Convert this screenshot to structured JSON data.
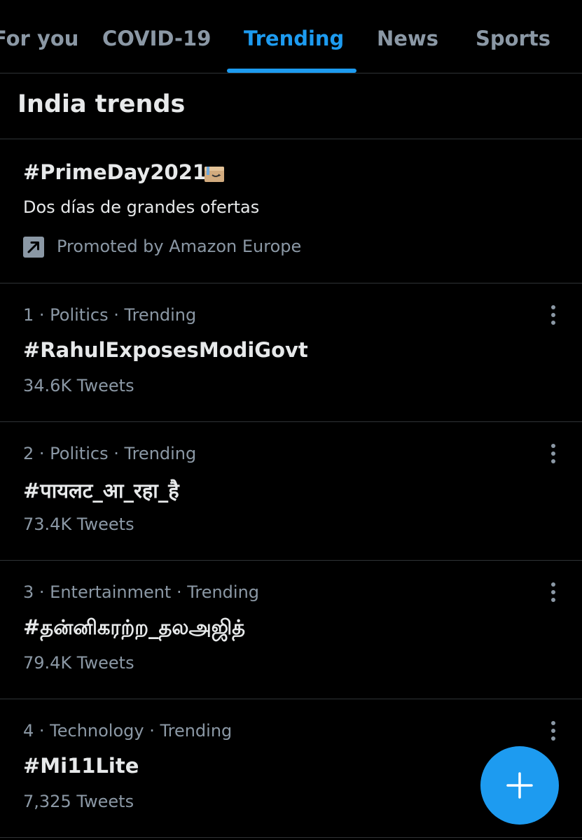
{
  "tabs": [
    {
      "label": "For you",
      "active": false
    },
    {
      "label": "COVID-19",
      "active": false
    },
    {
      "label": "Trending",
      "active": true
    },
    {
      "label": "News",
      "active": false
    },
    {
      "label": "Sports",
      "active": false
    }
  ],
  "section": {
    "title": "India trends"
  },
  "promoted": {
    "title": "#PrimeDay2021",
    "description": "Dos días de grandes ofertas",
    "promoted_by": "Promoted by Amazon Europe",
    "icon": "promoted-arrow-icon",
    "emoji": "package-emoji"
  },
  "trends": [
    {
      "meta": "1 · Politics · Trending",
      "name": "#RahulExposesModiGovt",
      "count": "34.6K Tweets"
    },
    {
      "meta": "2 · Politics · Trending",
      "name": "#पायलट_आ_रहा_है",
      "count": "73.4K Tweets"
    },
    {
      "meta": "3 · Entertainment · Trending",
      "name": "#தன்னிகரற்ற_தலஅஜித்",
      "count": "79.4K Tweets"
    },
    {
      "meta": "4 · Technology · Trending",
      "name": "#Mi11Lite",
      "count": "7,325 Tweets"
    }
  ],
  "fab": {
    "icon": "plus-icon"
  },
  "colors": {
    "background": "#000000",
    "accent": "#1d9bf0",
    "primary_text": "#e7e9ea",
    "secondary_text": "#8b98a5",
    "divider": "#2f3336"
  }
}
